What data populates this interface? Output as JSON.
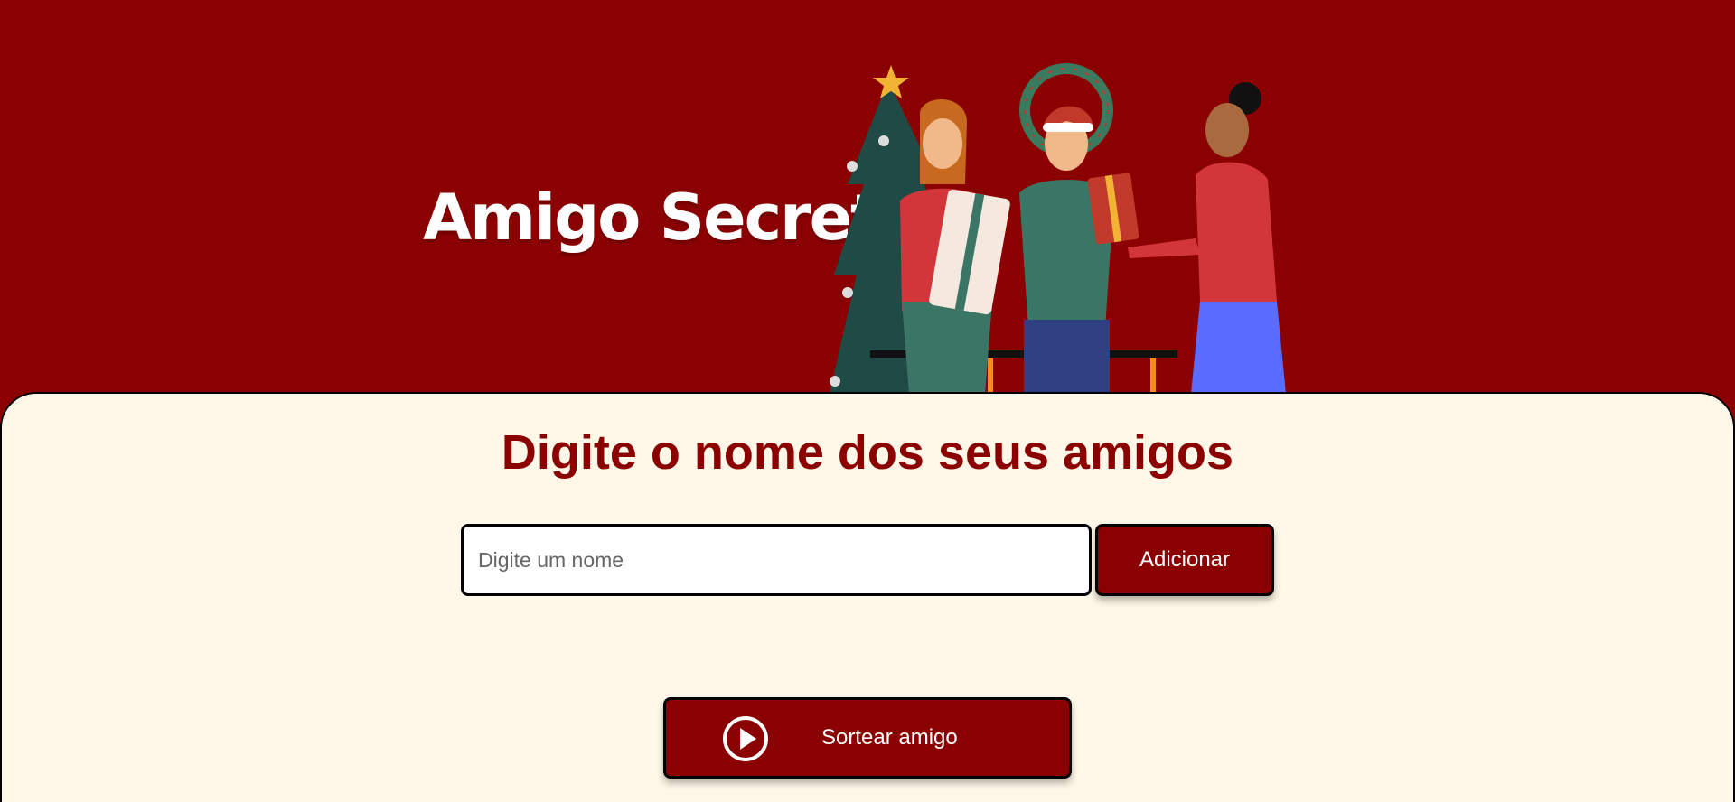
{
  "header": {
    "title": "Amigo Secreto",
    "background_color": "#8b0000",
    "illustration": "three-people-exchanging-christmas-gifts-illustration"
  },
  "main": {
    "heading": "Digite o nome dos seus amigos",
    "heading_color": "#8b0000",
    "background_color": "#fff8e8",
    "name_input": {
      "placeholder": "Digite um nome",
      "value": ""
    },
    "add_button": {
      "label": "Adicionar"
    },
    "friends_list": [],
    "result_list": [],
    "draw_button": {
      "label": "Sortear amigo",
      "icon": "play-circle-icon"
    }
  }
}
